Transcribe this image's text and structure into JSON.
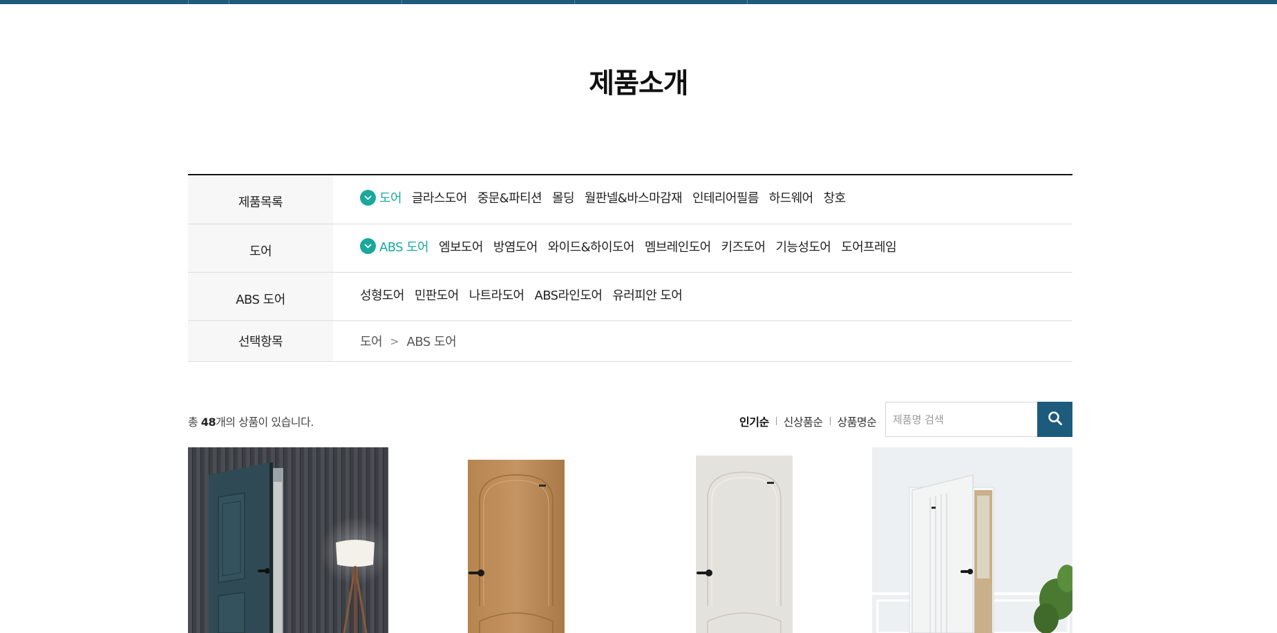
{
  "page": {
    "title": "제품소개"
  },
  "colors": {
    "accent": "#1aa89b",
    "brand": "#1d5b7c"
  },
  "filters": [
    {
      "header": "제품목록",
      "items": [
        "도어",
        "글라스도어",
        "중문&파티션",
        "몰딩",
        "월판넬&바스마감재",
        "인테리어필름",
        "하드웨어",
        "창호"
      ],
      "active": "도어"
    },
    {
      "header": "도어",
      "items": [
        "ABS 도어",
        "엠보도어",
        "방염도어",
        "와이드&하이도어",
        "멤브레인도어",
        "키즈도어",
        "기능성도어",
        "도어프레임"
      ],
      "active": "ABS 도어"
    },
    {
      "header": "ABS 도어",
      "items": [
        "성형도어",
        "민판도어",
        "나트라도어",
        "ABS라인도어",
        "유러피안 도어"
      ]
    }
  ],
  "selected": {
    "header": "선택항목",
    "path": [
      "도어",
      "ABS 도어"
    ],
    "separator": ">"
  },
  "listing": {
    "total_prefix": "총 ",
    "total_count": "48",
    "total_suffix": "개의 상품이 있습니다.",
    "sort_options": [
      "인기순",
      "신상품순",
      "상품명순"
    ],
    "active_sort": "인기순"
  },
  "search": {
    "placeholder": "제품명 검색",
    "value": "",
    "icon": "search-icon"
  },
  "products": [
    {
      "image": "dark-teal-door-room-photo"
    },
    {
      "image": "oak-wood-door"
    },
    {
      "image": "white-door"
    },
    {
      "image": "white-line-door-room-photo"
    }
  ]
}
